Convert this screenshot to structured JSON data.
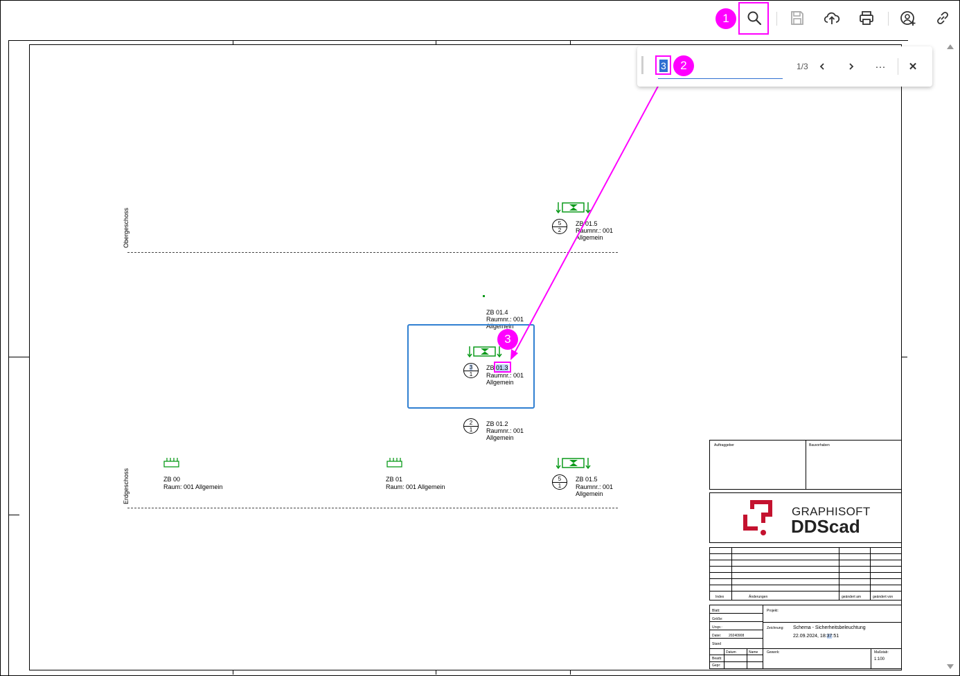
{
  "toolbar": {
    "icons": [
      "search-icon",
      "save-icon",
      "upload-cloud-icon",
      "print-icon",
      "share-user-icon",
      "link-icon"
    ]
  },
  "callouts": {
    "c1": "1",
    "c2": "2",
    "c3": "3"
  },
  "find": {
    "query": "3",
    "count": "1/3",
    "prev": "‹",
    "next": "›",
    "more": "···",
    "close": "✕"
  },
  "drawing": {
    "floor_og": "Obergeschoss",
    "floor_eg": "Erdgeschoss",
    "zb015_og": {
      "circ_top": "5",
      "circ_bottom": "2",
      "l1": "ZB 01.5",
      "l2": "Raumnr.: 001",
      "l3": "Allgemein"
    },
    "zb014": {
      "l1": "ZB 01.4",
      "l2": "Raumnr.: 001",
      "l3": "Allgemein"
    },
    "zb013": {
      "circ_top": "3",
      "circ_bottom": "1",
      "l1_pre": "ZB ",
      "l1_hl": "01.3",
      "l2": "Raumnr.: 001",
      "l3": "Allgemein"
    },
    "zb012": {
      "circ_top": "2",
      "circ_bottom": "1",
      "l1": "ZB 01.2",
      "l2": "Raumnr.: 001",
      "l3": "Allgemein"
    },
    "zb00": {
      "l1": "ZB 00",
      "l2": "Raum: 001 Allgemein"
    },
    "zb01": {
      "l1": "ZB 01",
      "l2": "Raum: 001 Allgemein"
    },
    "zb015_eg": {
      "circ_top": "5",
      "circ_bottom": "1",
      "l1": "ZB 01.5",
      "l2": "Raumnr.: 001",
      "l3": "Allgemein"
    }
  },
  "titleblock": {
    "auftraggeber": "Auftraggeber",
    "bauvorhaben": "Bauvorhaben",
    "logo_line1": "GRAPHISOFT",
    "logo_line2": "DDScad",
    "rev_index": "Index",
    "rev_aenderungen": "Änderungen",
    "rev_geaendert_am": "geändert am",
    "rev_geaendert_von": "geändert von",
    "blatt": "Blatt:",
    "groesse": "Größe:",
    "urspr": "Urspr.:",
    "datei": "Datei:",
    "datei_val": "20240908",
    "stand": "Stand",
    "datum": "Datum",
    "name": "Name",
    "bearb": "Bearb:",
    "gepr": "Gepr:",
    "projekt": "Projekt:",
    "zeichnung": "Zeichnung:",
    "zeichnung_title": "Schema - Sicherheitsbeleuchtung",
    "zeichnung_date_pre": "22.09.2024, 18:",
    "zeichnung_date_hl": "37",
    "zeichnung_date_post": ":51",
    "gewerk": "Gewerk:",
    "massstab": "Maßstab:",
    "massstab_val": "1:100"
  },
  "colors": {
    "accent": "#ff00ff",
    "select": "#2f6fd1",
    "symbol_green": "#0a9a1a"
  }
}
